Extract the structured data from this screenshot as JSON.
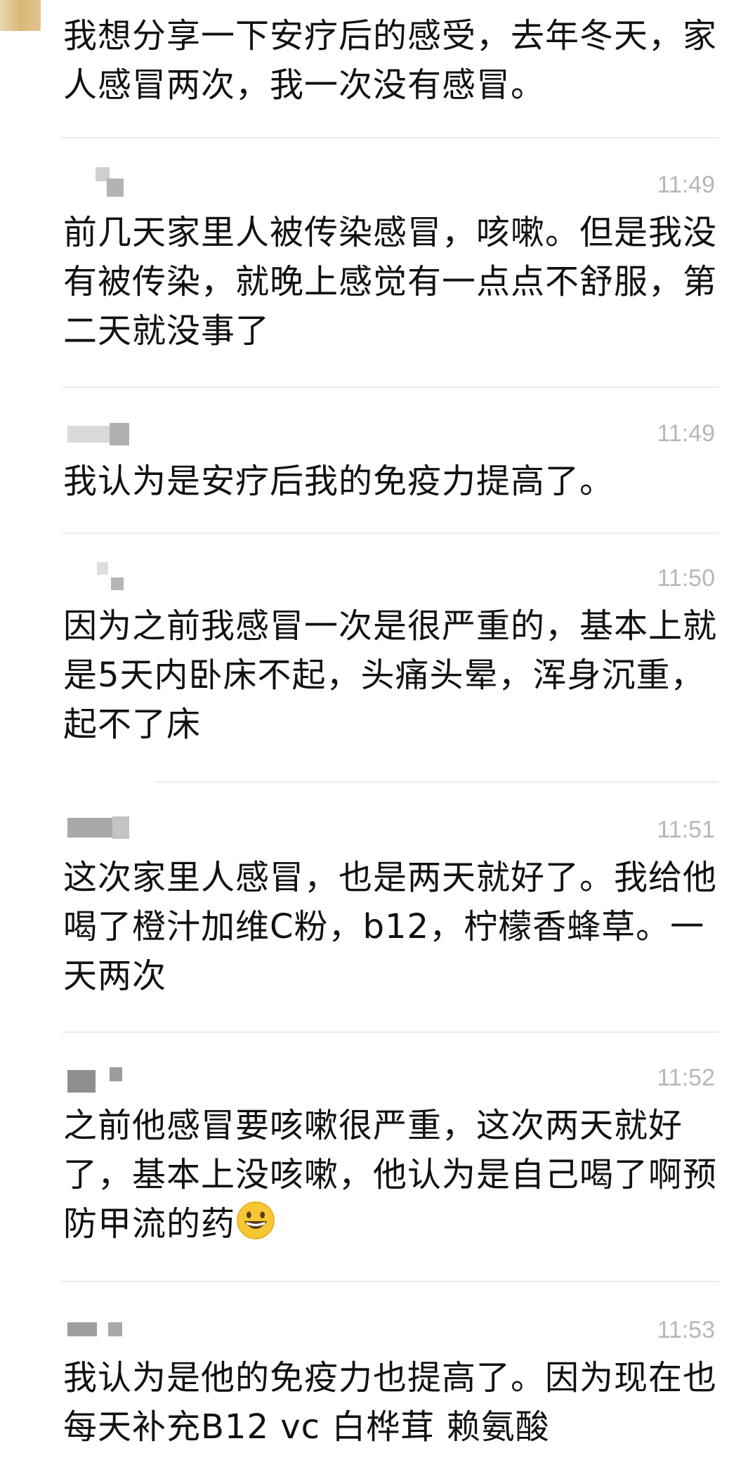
{
  "messages": [
    {
      "time": "",
      "text": "我想分享一下安疗后的感受，去年冬天，家人感冒两次，我一次没有感冒。"
    },
    {
      "time": "11:49",
      "text": "前几天家里人被传染感冒，咳嗽。但是我没有被传染，就晚上感觉有一点点不舒服，第二天就没事了"
    },
    {
      "time": "11:49",
      "text": "我认为是安疗后我的免疫力提高了。"
    },
    {
      "time": "11:50",
      "text": "因为之前我感冒一次是很严重的，基本上就是5天内卧床不起，头痛头晕，浑身沉重，起不了床"
    },
    {
      "time": "11:51",
      "text": "这次家里人感冒，也是两天就好了。我给他喝了橙汁加维C粉，b12，柠檬香蜂草。一天两次"
    },
    {
      "time": "11:52",
      "text": "之前他感冒要咳嗽很严重，这次两天就好了，基本上没咳嗽，他认为是自己喝了啊预防甲流的药"
    },
    {
      "time": "11:53",
      "text": "我认为是他的免疫力也提高了。因为现在也每天补充B12 vc 白桦茸 赖氨酸"
    }
  ],
  "emoji_icon": "grinning-face-icon",
  "colors": {
    "time": "#b7b7b7",
    "divider": "#ececec",
    "text": "#111111"
  }
}
